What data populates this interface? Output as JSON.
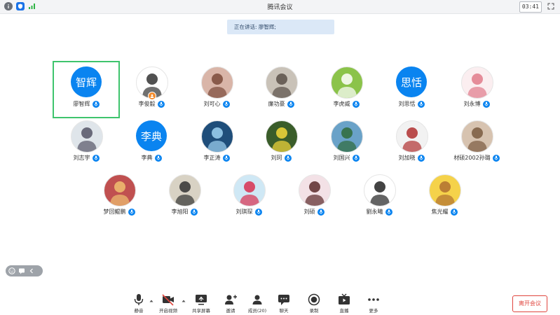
{
  "app": {
    "title": "腾讯会议",
    "clock": "03:41"
  },
  "banner": {
    "speaking": "正在讲话: 廖智辉;"
  },
  "participants": [
    {
      "name": "廖智辉",
      "avatar_text": "智辉",
      "active": true
    },
    {
      "name": "李俊毅",
      "host": true
    },
    {
      "name": "刘可心"
    },
    {
      "name": "廉功豪"
    },
    {
      "name": "李虎威"
    },
    {
      "name": "刘思恬",
      "avatar_text": "思恬"
    },
    {
      "name": "刘永博"
    },
    {
      "name": "刘志宇"
    },
    {
      "name": "李典",
      "avatar_text": "李典"
    },
    {
      "name": "李正涛"
    },
    {
      "name": "刘珂"
    },
    {
      "name": "刘国兴"
    },
    {
      "name": "刘加晓"
    },
    {
      "name": "材硕2002孙璐"
    },
    {
      "name": "梦回鲲鹏"
    },
    {
      "name": "李旭阳"
    },
    {
      "name": "刘琪琛"
    },
    {
      "name": "刘硕"
    },
    {
      "name": "劉永曦"
    },
    {
      "name": "焦光耀"
    }
  ],
  "toolbar": {
    "mute": "静音",
    "video": "开启视频",
    "share": "共享屏幕",
    "invite": "邀请",
    "members": "成员(20)",
    "chat": "聊天",
    "record": "录制",
    "live": "直播",
    "more": "更多",
    "leave": "离开会议"
  },
  "colors": {
    "accent": "#0a84f0",
    "active_outline": "#3ec46d",
    "leave": "#e0453e"
  }
}
